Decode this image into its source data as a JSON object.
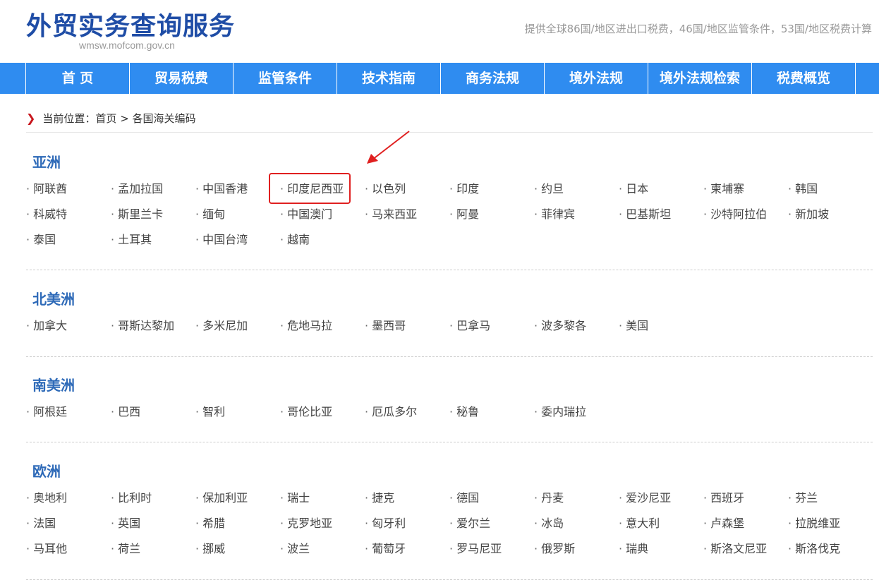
{
  "header": {
    "title": "外贸实务查询服务",
    "site_url": "wmsw.mofcom.gov.cn",
    "tagline": "提供全球86国/地区进出口税费，46国/地区监管条件，53国/地区税费计算"
  },
  "nav": {
    "items": [
      "首 页",
      "贸易税费",
      "监管条件",
      "技术指南",
      "商务法规",
      "境外法规",
      "境外法规检索",
      "税费概览"
    ]
  },
  "breadcrumb": {
    "prefix": "当前位置：",
    "home": "首页",
    "separator": " > ",
    "current": "各国海关编码"
  },
  "regions": [
    {
      "name": "亚洲",
      "countries": [
        "阿联酋",
        "孟加拉国",
        "中国香港",
        "印度尼西亚",
        "以色列",
        "印度",
        "约旦",
        "日本",
        "柬埔寨",
        "韩国",
        "科威特",
        "斯里兰卡",
        "缅甸",
        "中国澳门",
        "马来西亚",
        "阿曼",
        "菲律宾",
        "巴基斯坦",
        "沙特阿拉伯",
        "新加坡",
        "泰国",
        "土耳其",
        "中国台湾",
        "越南"
      ]
    },
    {
      "name": "北美洲",
      "countries": [
        "加拿大",
        "哥斯达黎加",
        "多米尼加",
        "危地马拉",
        "墨西哥",
        "巴拿马",
        "波多黎各",
        "美国"
      ]
    },
    {
      "name": "南美洲",
      "countries": [
        "阿根廷",
        "巴西",
        "智利",
        "哥伦比亚",
        "厄瓜多尔",
        "秘鲁",
        "委内瑞拉"
      ]
    },
    {
      "name": "欧洲",
      "countries": [
        "奥地利",
        "比利时",
        "保加利亚",
        "瑞士",
        "捷克",
        "德国",
        "丹麦",
        "爱沙尼亚",
        "西班牙",
        "芬兰",
        "法国",
        "英国",
        "希腊",
        "克罗地亚",
        "匈牙利",
        "爱尔兰",
        "冰岛",
        "意大利",
        "卢森堡",
        "拉脱维亚",
        "马耳他",
        "荷兰",
        "挪威",
        "波兰",
        "葡萄牙",
        "罗马尼亚",
        "俄罗斯",
        "瑞典",
        "斯洛文尼亚",
        "斯洛伐克"
      ]
    }
  ],
  "annotation": {
    "highlighted_country": "印度尼西亚",
    "color": "#e02020"
  },
  "colors": {
    "nav_bg": "#2f8cf0",
    "title": "#1f4da6",
    "region_title": "#2e6ab8",
    "breadcrumb_arrow": "#c8161d"
  }
}
